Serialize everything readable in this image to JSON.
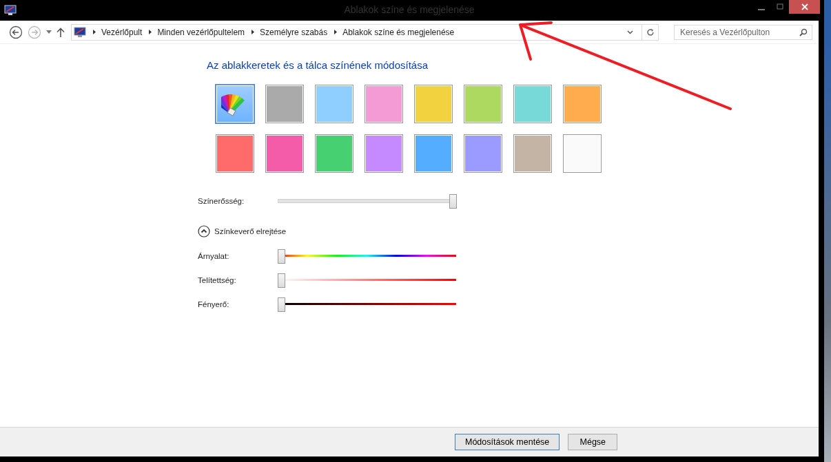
{
  "window": {
    "title": "Ablakok színe és megjelenése"
  },
  "breadcrumbs": [
    "Vezérlőpult",
    "Minden vezérlőpultelem",
    "Személyre szabás",
    "Ablakok színe és megjelenése"
  ],
  "search": {
    "placeholder": "Keresés a Vezérlőpulton"
  },
  "heading": "Az ablakkeretek és a tálca színének módosítása",
  "swatches": [
    {
      "kind": "palette",
      "selected": true
    },
    {
      "kind": "color",
      "color": "#aaaaaa",
      "selected": false
    },
    {
      "kind": "color",
      "color": "#8ecfff",
      "selected": false
    },
    {
      "kind": "color",
      "color": "#f49bd6",
      "selected": false
    },
    {
      "kind": "color",
      "color": "#f2d23f",
      "selected": false
    },
    {
      "kind": "color",
      "color": "#aed960",
      "selected": false
    },
    {
      "kind": "color",
      "color": "#77d9d8",
      "selected": false
    },
    {
      "kind": "color",
      "color": "#ffac4f",
      "selected": false
    },
    {
      "kind": "color",
      "color": "#ff6b6b",
      "selected": false
    },
    {
      "kind": "color",
      "color": "#f45ba9",
      "selected": false
    },
    {
      "kind": "color",
      "color": "#47d072",
      "selected": false
    },
    {
      "kind": "color",
      "color": "#c58aff",
      "selected": false
    },
    {
      "kind": "color",
      "color": "#55adff",
      "selected": false
    },
    {
      "kind": "color",
      "color": "#9a9aff",
      "selected": false
    },
    {
      "kind": "color",
      "color": "#c4b4a6",
      "selected": false
    },
    {
      "kind": "color",
      "color": "#fafafa",
      "selected": false
    }
  ],
  "intensity": {
    "label": "Színerősség:",
    "level": 1
  },
  "mixer": {
    "label": "Színkeverő elrejtése",
    "expanded": true
  },
  "mixer_sliders": [
    {
      "kind": "hue",
      "label": "Árnyalat:",
      "level": 0
    },
    {
      "kind": "saturation",
      "label": "Telítettség:",
      "level": 0
    },
    {
      "kind": "brightness",
      "label": "Fényerő:",
      "level": 0
    }
  ],
  "buttons": [
    {
      "label": "Módosítások mentése",
      "default": true
    },
    {
      "label": "Mégse",
      "default": false
    }
  ]
}
